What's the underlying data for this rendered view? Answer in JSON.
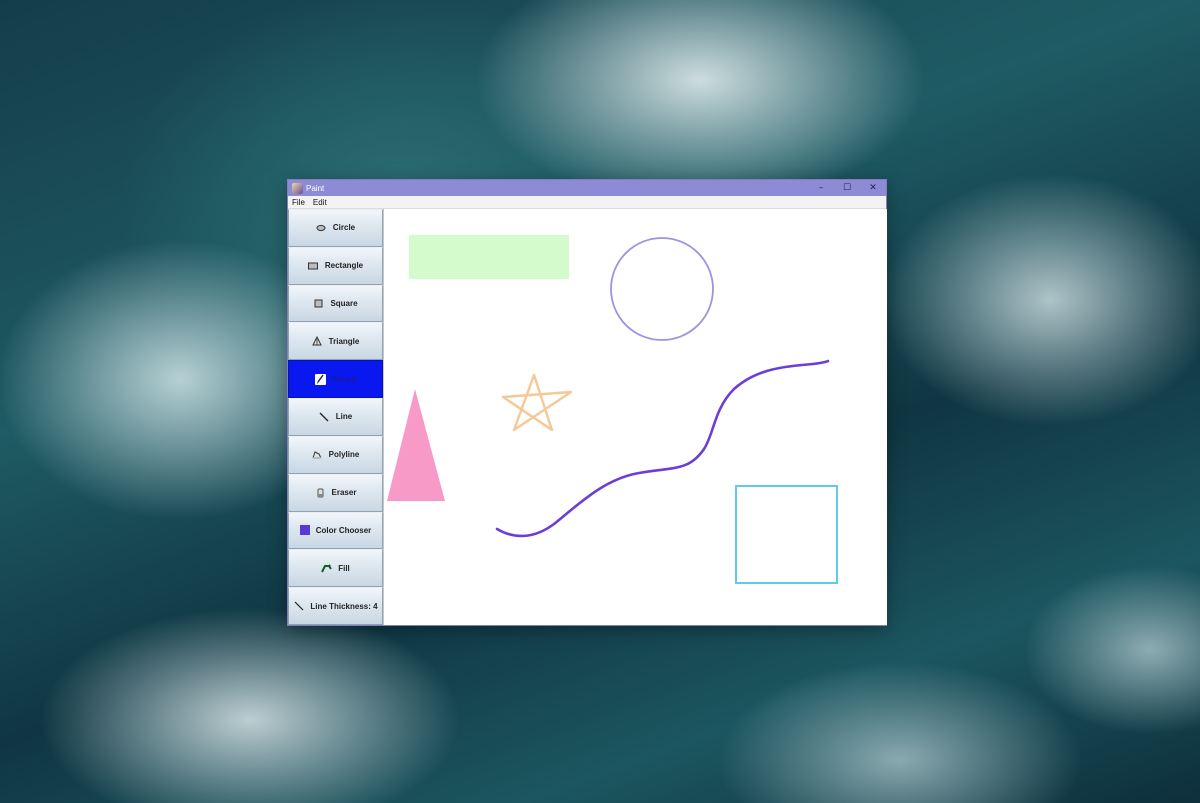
{
  "window": {
    "title": "Paint",
    "controls": {
      "minimize": "–",
      "maximize": "☐",
      "close": "✕"
    }
  },
  "menu": [
    "File",
    "Edit"
  ],
  "toolbar": {
    "selected_tool": "Pencil",
    "tools": [
      {
        "label": "Circle",
        "icon": "circle-icon"
      },
      {
        "label": "Rectangle",
        "icon": "rectangle-icon"
      },
      {
        "label": "Square",
        "icon": "square-icon"
      },
      {
        "label": "Triangle",
        "icon": "triangle-icon"
      },
      {
        "label": "Pencil",
        "icon": "pencil-icon"
      },
      {
        "label": "Line",
        "icon": "line-icon"
      },
      {
        "label": "Polyline",
        "icon": "polyline-icon"
      },
      {
        "label": "Eraser",
        "icon": "eraser-icon"
      },
      {
        "label": "Color Chooser",
        "icon": "color-swatch-icon"
      },
      {
        "label": "Fill",
        "icon": "fill-icon"
      },
      {
        "label": "Line Thickness: 4",
        "icon": "line-thickness-icon"
      }
    ],
    "current_color": "#5a3ad6"
  },
  "canvas": {
    "background": "#ffffff",
    "shapes": [
      {
        "type": "filled-rectangle",
        "color": "#d3fbcc"
      },
      {
        "type": "circle-outline",
        "color": "#9b94e0"
      },
      {
        "type": "freehand-curve",
        "color": "#6a3fd8"
      },
      {
        "type": "filled-triangle",
        "color": "#f79ac8"
      },
      {
        "type": "star-outline",
        "color": "#f5c896"
      },
      {
        "type": "square-outline",
        "color": "#63c9e8"
      }
    ]
  }
}
